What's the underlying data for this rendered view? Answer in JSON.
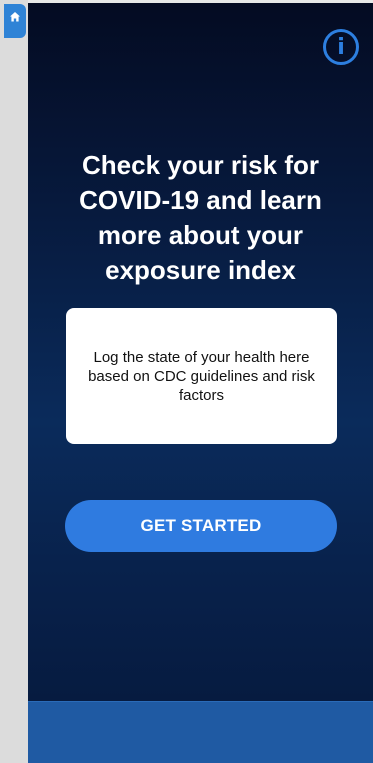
{
  "nav": {
    "home_icon": "home-icon"
  },
  "header": {
    "info_icon": "info-icon",
    "info_glyph": "i"
  },
  "main": {
    "headline": "Check your risk for COVID-19 and learn more about your exposure index",
    "card_text": "Log the state of your health here based on CDC guidelines and risk factors",
    "cta_label": "GET STARTED"
  },
  "colors": {
    "accent": "#2f7be0",
    "panel_top": "#040b22",
    "panel_bottom": "#061b40",
    "bottom_bar": "#1f5aa3"
  }
}
